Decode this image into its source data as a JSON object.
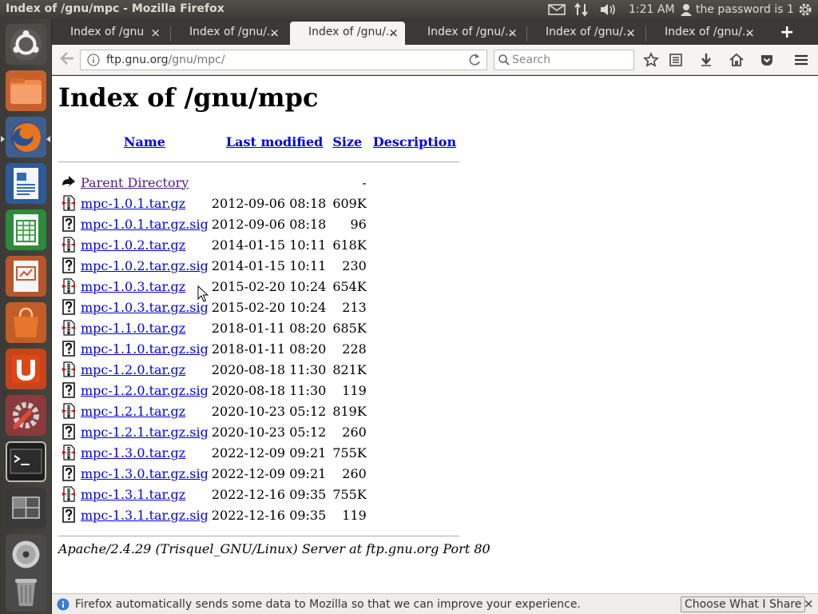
{
  "window": {
    "title": "Index of /gnu/mpc - Mozilla Firefox"
  },
  "tray": {
    "time": "1:21 AM",
    "user": "the password is 1"
  },
  "tabs": [
    {
      "label": "Index of /gnu",
      "active": false
    },
    {
      "label": "Index of /gnu/...",
      "active": false
    },
    {
      "label": "Index of /gnu/...",
      "active": true
    },
    {
      "label": "Index of /gnu/...",
      "active": false
    },
    {
      "label": "Index of /gnu/...",
      "active": false
    },
    {
      "label": "Index of /gnu/...",
      "active": false
    }
  ],
  "tab_close_glyph": "×",
  "new_tab_glyph": "+",
  "urlbar": {
    "host": "ftp.gnu.org",
    "path": "/gnu/mpc/"
  },
  "searchbar": {
    "placeholder": "Search"
  },
  "page": {
    "title": "Index of /gnu/mpc",
    "headers": {
      "name": "Name",
      "last_modified": "Last modified",
      "size": "Size",
      "description": "Description"
    },
    "parent": {
      "name": "Parent Directory",
      "size": "-"
    },
    "files": [
      {
        "name": "mpc-1.0.1.tar.gz",
        "date": "2012-09-06 08:18",
        "size": "609K",
        "kind": "archive"
      },
      {
        "name": "mpc-1.0.1.tar.gz.sig",
        "date": "2012-09-06 08:18",
        "size": "96",
        "kind": "unknown"
      },
      {
        "name": "mpc-1.0.2.tar.gz",
        "date": "2014-01-15 10:11",
        "size": "618K",
        "kind": "archive"
      },
      {
        "name": "mpc-1.0.2.tar.gz.sig",
        "date": "2014-01-15 10:11",
        "size": "230",
        "kind": "unknown"
      },
      {
        "name": "mpc-1.0.3.tar.gz",
        "date": "2015-02-20 10:24",
        "size": "654K",
        "kind": "archive"
      },
      {
        "name": "mpc-1.0.3.tar.gz.sig",
        "date": "2015-02-20 10:24",
        "size": "213",
        "kind": "unknown"
      },
      {
        "name": "mpc-1.1.0.tar.gz",
        "date": "2018-01-11 08:20",
        "size": "685K",
        "kind": "archive"
      },
      {
        "name": "mpc-1.1.0.tar.gz.sig",
        "date": "2018-01-11 08:20",
        "size": "228",
        "kind": "unknown"
      },
      {
        "name": "mpc-1.2.0.tar.gz",
        "date": "2020-08-18 11:30",
        "size": "821K",
        "kind": "archive"
      },
      {
        "name": "mpc-1.2.0.tar.gz.sig",
        "date": "2020-08-18 11:30",
        "size": "119",
        "kind": "unknown"
      },
      {
        "name": "mpc-1.2.1.tar.gz",
        "date": "2020-10-23 05:12",
        "size": "819K",
        "kind": "archive"
      },
      {
        "name": "mpc-1.2.1.tar.gz.sig",
        "date": "2020-10-23 05:12",
        "size": "260",
        "kind": "unknown"
      },
      {
        "name": "mpc-1.3.0.tar.gz",
        "date": "2022-12-09 09:21",
        "size": "755K",
        "kind": "archive"
      },
      {
        "name": "mpc-1.3.0.tar.gz.sig",
        "date": "2022-12-09 09:21",
        "size": "260",
        "kind": "unknown"
      },
      {
        "name": "mpc-1.3.1.tar.gz",
        "date": "2022-12-16 09:35",
        "size": "755K",
        "kind": "archive"
      },
      {
        "name": "mpc-1.3.1.tar.gz.sig",
        "date": "2022-12-16 09:35",
        "size": "119",
        "kind": "unknown"
      }
    ],
    "address": "Apache/2.4.29 (Trisquel_GNU/Linux) Server at ftp.gnu.org Port 80"
  },
  "notification": {
    "text": "Firefox automatically sends some data to Mozilla so that we can improve your experience.",
    "button": "Choose What I Share",
    "close_glyph": "×"
  },
  "launcher": [
    {
      "name": "dash-home-icon",
      "color": "#5a5954"
    },
    {
      "name": "files-icon",
      "color": "#e9773a"
    },
    {
      "name": "firefox-icon",
      "color": "#d96a1f"
    },
    {
      "name": "writer-icon",
      "color": "#2f6fb3"
    },
    {
      "name": "calc-icon",
      "color": "#2e9a3b"
    },
    {
      "name": "impress-icon",
      "color": "#c9592a"
    },
    {
      "name": "software-center-icon",
      "color": "#e06a2a"
    },
    {
      "name": "ubuntu-one-icon",
      "color": "#dd4814"
    },
    {
      "name": "system-settings-icon",
      "color": "#a04040"
    },
    {
      "name": "terminal-icon",
      "color": "#2c2c2c"
    },
    {
      "name": "workspace-switcher-icon",
      "color": "#3a3a3a"
    },
    {
      "name": "disc-icon",
      "color": "#6a6a6a"
    },
    {
      "name": "trash-icon",
      "color": "#5a5a5a"
    }
  ]
}
